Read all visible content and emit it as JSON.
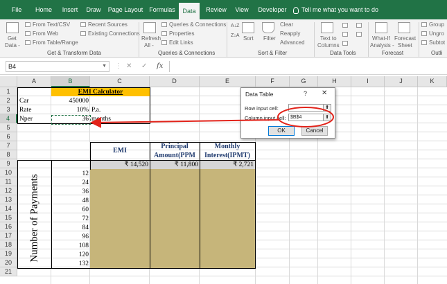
{
  "ribbon_tabs": {
    "file": "File",
    "home": "Home",
    "insert": "Insert",
    "draw": "Draw",
    "page_layout": "Page Layout",
    "formulas": "Formulas",
    "data": "Data",
    "review": "Review",
    "view": "View",
    "developer": "Developer",
    "tell_me": "Tell me what you want to do"
  },
  "ribbon": {
    "get_data": "Get",
    "get_data_2": "Data -",
    "from_text_csv": "From Text/CSV",
    "from_web": "From Web",
    "from_table_range": "From Table/Range",
    "recent_sources": "Recent Sources",
    "existing_connections": "Existing Connections",
    "group_get_transform": "Get & Transform Data",
    "refresh_all": "Refresh",
    "refresh_all_2": "All -",
    "queries_connections": "Queries & Connections",
    "properties": "Properties",
    "edit_links": "Edit Links",
    "group_queries": "Queries & Connections",
    "sort": "Sort",
    "filter": "Filter",
    "clear": "Clear",
    "reapply": "Reapply",
    "advanced": "Advanced",
    "group_sort_filter": "Sort & Filter",
    "text_to_columns": "Text to",
    "text_to_columns_2": "Columns",
    "group_data_tools": "Data Tools",
    "what_if": "What-If",
    "what_if_2": "Analysis -",
    "forecast_sheet": "Forecast",
    "forecast_sheet_2": "Sheet",
    "group_forecast": "Forecast",
    "group_btn": "Group",
    "ungroup_btn": "Ungro",
    "subtotal_btn": "Subtot",
    "group_outline": "Outli"
  },
  "formula_bar": {
    "name_box": "B4",
    "fx": "fx",
    "cancel_icon": "✕",
    "enter_icon": "✓",
    "formula": ""
  },
  "columns": [
    "A",
    "B",
    "C",
    "D",
    "E",
    "F",
    "G",
    "H",
    "I",
    "J",
    "K"
  ],
  "rows": [
    "1",
    "2",
    "3",
    "4",
    "5",
    "6",
    "7",
    "8",
    "9",
    "10",
    "11",
    "12",
    "13",
    "14",
    "15",
    "16",
    "17",
    "18",
    "19",
    "20",
    "21"
  ],
  "sheet": {
    "title": "EMI Calculator",
    "car_label": "Car",
    "car_value": "450000",
    "rate_label": "Rate",
    "rate_value": "10%",
    "rate_unit": "P.a.",
    "nper_label": "Nper",
    "nper_value": "36",
    "nper_unit": "months",
    "hdr_emi": "EMI",
    "hdr_principal_1": "Principal",
    "hdr_principal_2": "Amount(PPM",
    "hdr_interest_1": "Monthly",
    "hdr_interest_2": "Interest(IPMT)",
    "emi_value": "₹ 14,520",
    "principal_value": "₹ 11,800",
    "interest_value": "₹ 2,721",
    "vertical_label": "Number of Payments",
    "payments": [
      "12",
      "24",
      "36",
      "48",
      "60",
      "72",
      "84",
      "96",
      "108",
      "120",
      "132"
    ]
  },
  "dialog": {
    "title": "Data Table",
    "help": "?",
    "close": "✕",
    "row_label": "Row input cell:",
    "row_value": "",
    "col_label": "Column input cell:",
    "col_value": "$B$4",
    "ok": "OK",
    "cancel": "Cancel"
  },
  "colors": {
    "excel_green": "#217346",
    "title_fill": "#ffc000",
    "table_fill": "#c6b57a",
    "annotation_red": "#e2231a"
  }
}
